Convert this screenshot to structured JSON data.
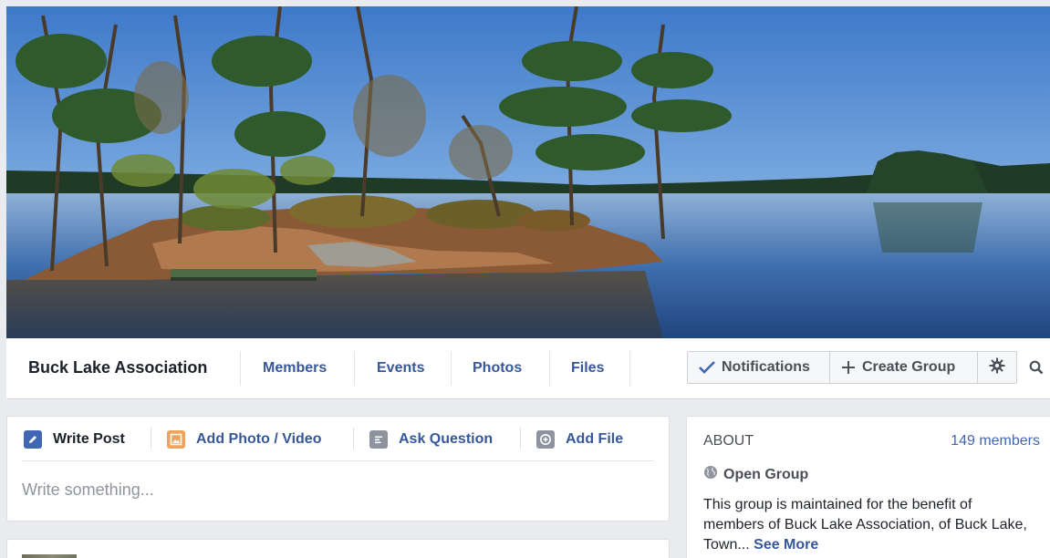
{
  "cover": {
    "alt": ""
  },
  "nav": {
    "group_name": "Buck Lake Association",
    "tabs": [
      {
        "label": "Members"
      },
      {
        "label": "Events"
      },
      {
        "label": "Photos"
      },
      {
        "label": "Files"
      }
    ],
    "notifications_label": "Notifications",
    "create_group_label": "Create Group"
  },
  "composer": {
    "actions": [
      {
        "label": "Write Post",
        "icon": "pencil-icon",
        "color": "#4267b2"
      },
      {
        "label": "Add Photo / Video",
        "icon": "photo-icon",
        "color": "#f0a25b"
      },
      {
        "label": "Ask Question",
        "icon": "question-icon",
        "color": "#8d949e"
      },
      {
        "label": "Add File",
        "icon": "file-icon",
        "color": "#8d949e"
      }
    ],
    "placeholder": "Write something..."
  },
  "about": {
    "title": "ABOUT",
    "member_count": "149 members",
    "privacy": "Open Group",
    "description": "This group is maintained for the benefit of members of Buck Lake Association, of Buck Lake, Town...",
    "see_more": "See More"
  },
  "colors": {
    "link": "#365899",
    "accent": "#4267b2",
    "page_bg": "#e9ebee"
  }
}
